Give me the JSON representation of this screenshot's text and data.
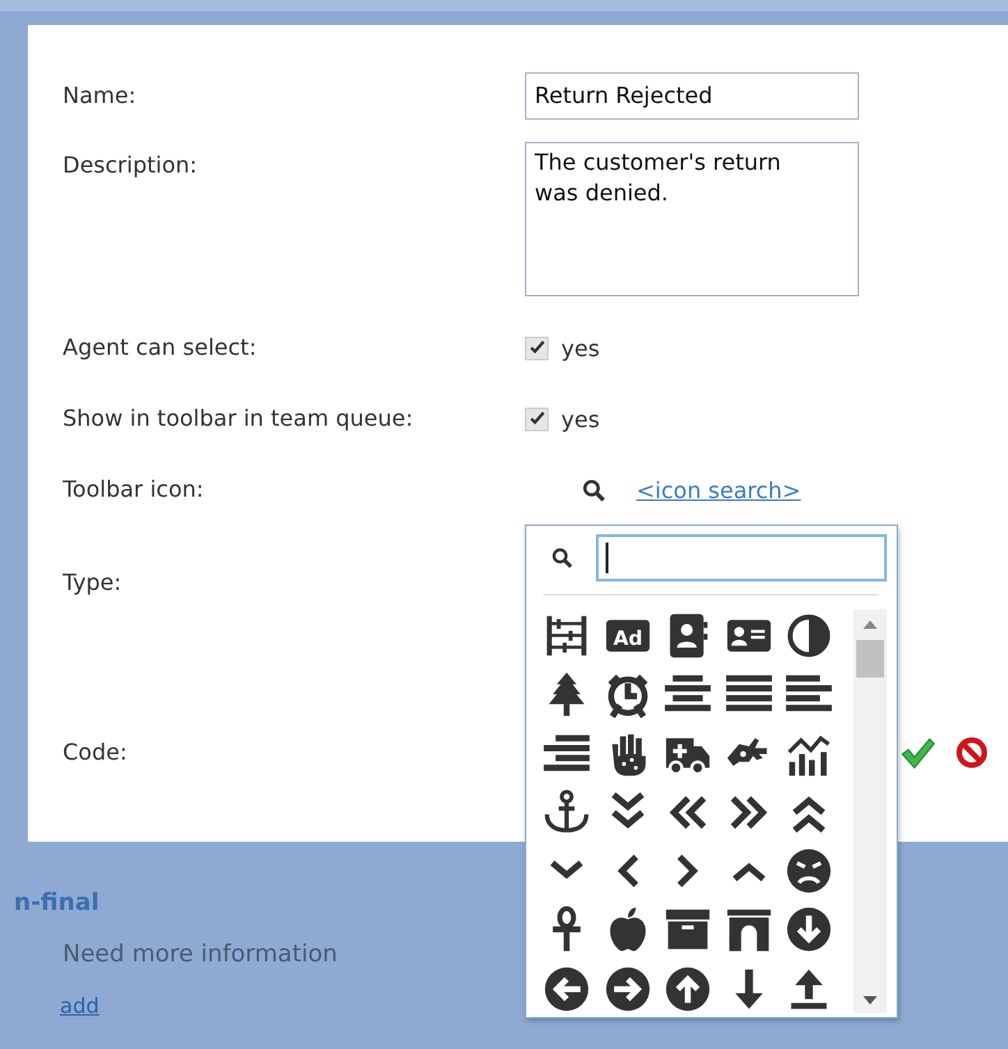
{
  "form": {
    "name": {
      "label": "Name:",
      "value": "Return Rejected"
    },
    "description": {
      "label": "Description:",
      "value": "The customer's return was denied."
    },
    "agent_can_select": {
      "label": "Agent can select:",
      "checked": true,
      "option": "yes"
    },
    "show_in_toolbar": {
      "label": "Show in toolbar in team queue:",
      "checked": true,
      "option": "yes"
    },
    "toolbar_icon": {
      "label": "Toolbar icon:",
      "link": "<icon search>"
    },
    "type": {
      "label": "Type:"
    },
    "code": {
      "label": "Code:"
    }
  },
  "icon_picker": {
    "ad_label": "Ad"
  },
  "section": {
    "title": "n-final",
    "items": [
      "Need more information"
    ],
    "add_link": "add"
  }
}
